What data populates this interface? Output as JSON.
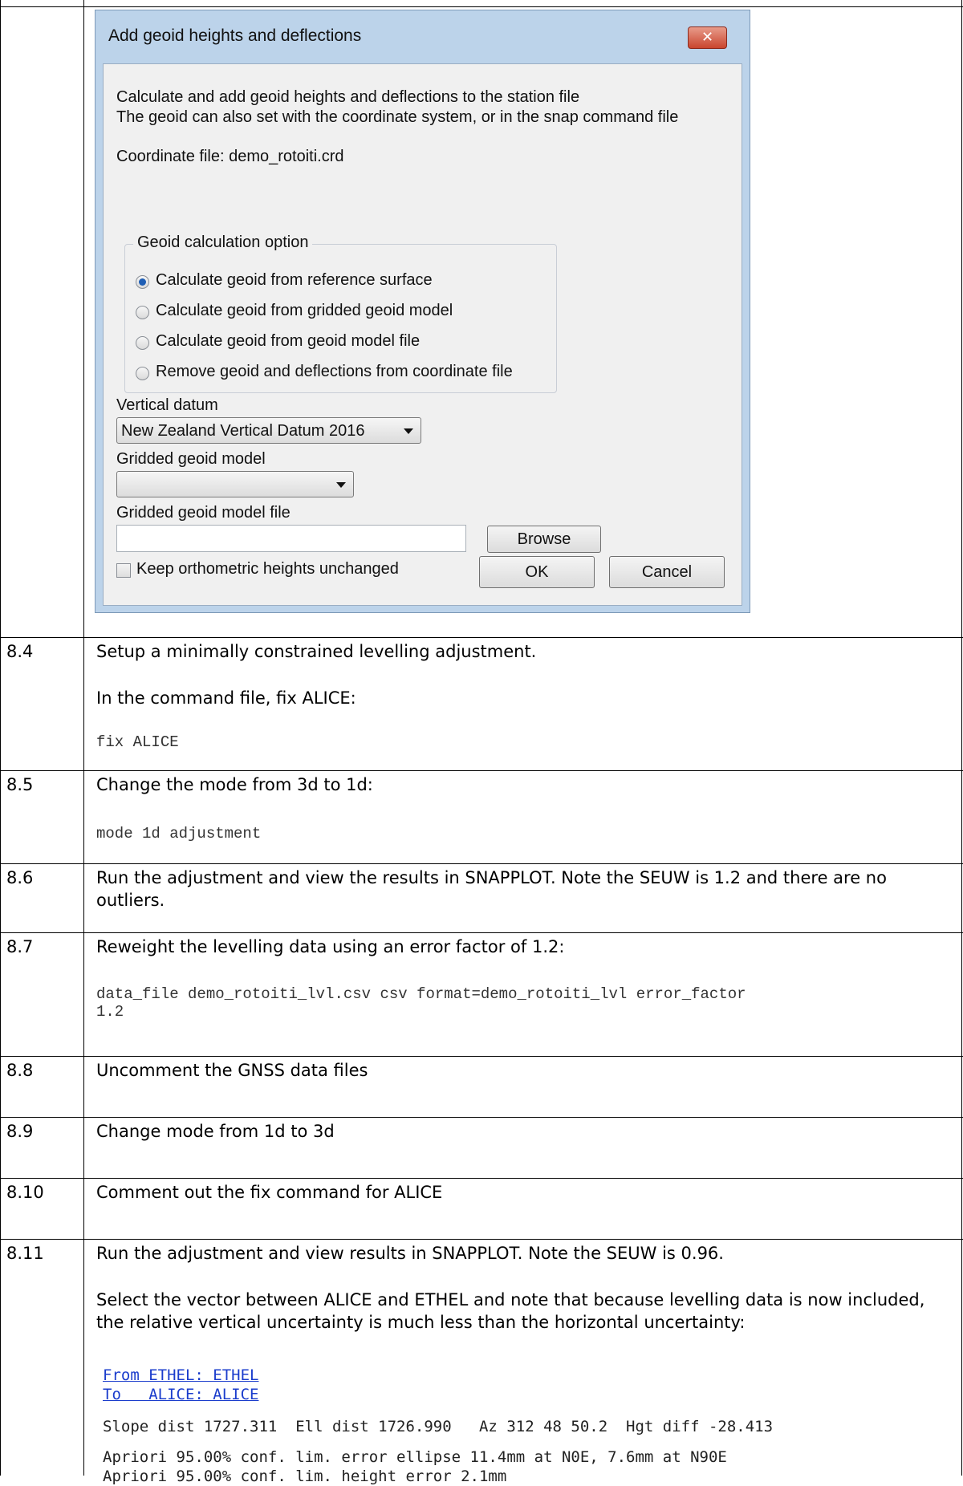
{
  "dialog": {
    "title": "Add geoid heights and deflections",
    "close_label": "✕",
    "intro_line1": "Calculate and add geoid heights and deflections to the station file",
    "intro_line2": "The geoid can also set with the coordinate system, or in the snap command file",
    "coordinate_file": "Coordinate file: demo_rotoiti.crd",
    "group_label": "Geoid calculation option",
    "options": [
      {
        "label": "Calculate geoid from reference surface",
        "selected": true
      },
      {
        "label": "Calculate geoid from gridded geoid model",
        "selected": false
      },
      {
        "label": "Calculate geoid from geoid model file",
        "selected": false
      },
      {
        "label": "Remove geoid and deflections from coordinate file",
        "selected": false
      }
    ],
    "vertical_datum_label": "Vertical datum",
    "vertical_datum_value": "New Zealand Vertical Datum 2016",
    "gridded_model_label": "Gridded geoid model",
    "gridded_model_value": "",
    "gridded_model_file_label": "Gridded geoid model file",
    "gridded_model_file_value": "",
    "browse_label": "Browse",
    "keep_heights_label": "Keep orthometric heights unchanged",
    "keep_heights_checked": false,
    "ok_label": "OK",
    "cancel_label": "Cancel"
  },
  "steps": [
    {
      "num": "8.4",
      "text": "Setup a minimally constrained levelling adjustment.",
      "text2": "In the command file, fix ALICE:",
      "code": "fix ALICE"
    },
    {
      "num": "8.5",
      "text": "Change the mode from 3d to 1d:",
      "code": "mode 1d adjustment"
    },
    {
      "num": "8.6",
      "text": "Run the adjustment and view the results in SNAPPLOT. Note the SEUW is 1.2 and there are no outliers."
    },
    {
      "num": "8.7",
      "text": "Reweight the levelling data using an error factor of 1.2:",
      "code": "data_file demo_rotoiti_lvl.csv csv format=demo_rotoiti_lvl error_factor\n1.2"
    },
    {
      "num": "8.8",
      "text": "Uncomment the GNSS data files"
    },
    {
      "num": "8.9",
      "text": "Change mode from 1d to 3d"
    },
    {
      "num": "8.10",
      "text": "Comment out the fix command for ALICE"
    },
    {
      "num": "8.11",
      "text": "Run the adjustment and view results in SNAPPLOT. Note the SEUW is 0.96.",
      "text2": "Select the vector between ALICE and ETHEL and note that because levelling data is now included, the relative vertical uncertainty is much less than the horizontal uncertainty:"
    }
  ],
  "output": {
    "from_line": "From ETHEL: ETHEL",
    "to_line": "To   ALICE: ALICE",
    "slope_line": "Slope dist 1727.311  Ell dist 1726.990   Az 312 48 50.2  Hgt diff -28.413",
    "apriori_line1": "Apriori 95.00% conf. lim. error ellipse 11.4mm at N0E, 7.6mm at N90E",
    "apriori_line2": "Apriori 95.00% conf. lim. height error 2.1mm"
  }
}
